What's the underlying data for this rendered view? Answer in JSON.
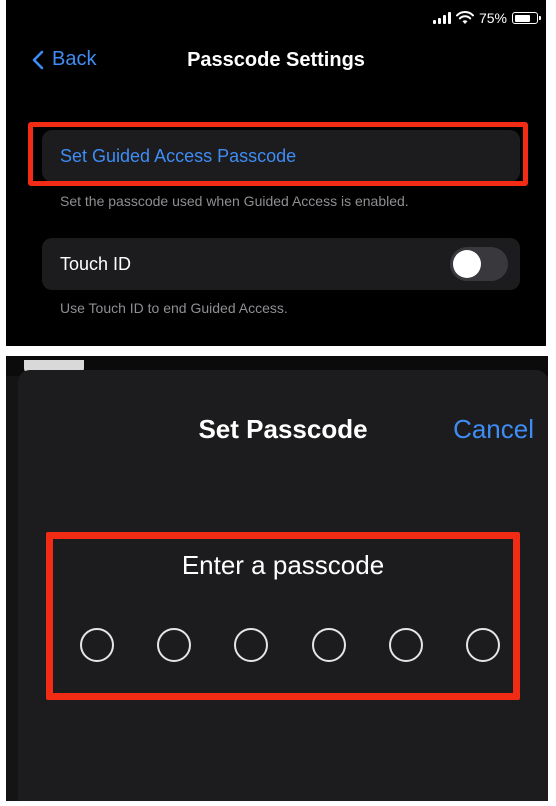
{
  "status_bar": {
    "battery_percent": "75%",
    "icons": [
      "signal-icon",
      "wifi-icon",
      "battery-icon"
    ]
  },
  "passcode_settings": {
    "nav": {
      "back_label": "Back",
      "title": "Passcode Settings"
    },
    "set_passcode_label": "Set Guided Access Passcode",
    "set_passcode_footer": "Set the passcode used when Guided Access is enabled.",
    "touch_id_label": "Touch ID",
    "touch_id_enabled": false,
    "touch_id_footer": "Use Touch ID to end Guided Access."
  },
  "set_passcode_sheet": {
    "title": "Set Passcode",
    "cancel_label": "Cancel",
    "prompt": "Enter a passcode",
    "digits_total": 6,
    "digits_entered": 0
  },
  "colors": {
    "accent": "#3f8cf5",
    "highlight": "#f22b14",
    "cell_background": "#1c1c1e",
    "footer_text": "#8e8e93"
  }
}
